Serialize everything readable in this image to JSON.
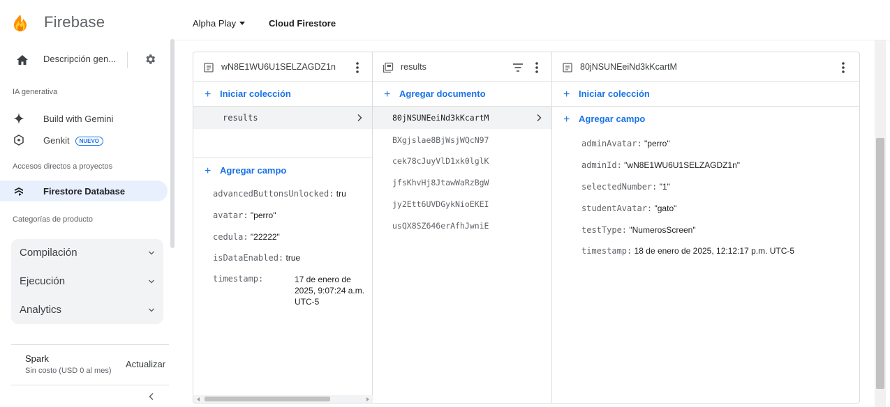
{
  "brand": {
    "name": "Firebase"
  },
  "sidebar": {
    "project_overview": "Descripción gen...",
    "section_genai": "IA generativa",
    "genai_items": [
      {
        "label": "Build with Gemini",
        "icon": "sparkle-icon"
      },
      {
        "label": "Genkit",
        "badge": "NUEVO",
        "icon": "genkit-icon"
      }
    ],
    "section_shortcuts": "Accesos directos a proyectos",
    "active_item": {
      "label": "Firestore Database",
      "icon": "firestore-icon"
    },
    "section_categories": "Categorías de producto",
    "categories": [
      {
        "label": "Compilación"
      },
      {
        "label": "Ejecución"
      },
      {
        "label": "Analytics"
      }
    ],
    "plan": {
      "name": "Spark",
      "subtitle": "Sin costo (USD 0 al mes)",
      "upgrade": "Actualizar"
    }
  },
  "topbar": {
    "project": "Alpha Play",
    "product": "Cloud Firestore"
  },
  "columns": {
    "root": {
      "title": "wN8E1WU6U1SELZAGDZ1n",
      "action": "Iniciar colección",
      "collections": [
        "results"
      ],
      "add_field": "Agregar campo",
      "fields": [
        {
          "key": "advancedButtonsUnlocked:",
          "value": "tru"
        },
        {
          "key": "avatar:",
          "value": "\"perro\""
        },
        {
          "key": "cedula:",
          "value": "\"22222\""
        },
        {
          "key": "isDataEnabled:",
          "value": "true"
        }
      ],
      "timestamp": {
        "key": "timestamp:",
        "value": "17 de enero de 2025, 9:07:24 a.m. UTC-5"
      }
    },
    "collection": {
      "title": "results",
      "action": "Agregar documento",
      "documents": [
        "80jNSUNEeiNd3kKcartM",
        "BXgjslae8BjWsjWQcN97",
        "cek78cJuyVlD1xk0lglK",
        "jfsKhvHj8JtawWaRzBgW",
        "jy2Ett6UVDGykNioEKEI",
        "usQX8SZ646erAfhJwniE"
      ]
    },
    "document": {
      "title": "80jNSUNEeiNd3kKcartM",
      "action": "Iniciar colección",
      "add_field": "Agregar campo",
      "fields": [
        {
          "key": "adminAvatar:",
          "value": "\"perro\""
        },
        {
          "key": "adminId:",
          "value": "\"wN8E1WU6U1SELZAGDZ1n\""
        },
        {
          "key": "selectedNumber:",
          "value": "\"1\""
        },
        {
          "key": "studentAvatar:",
          "value": "\"gato\""
        },
        {
          "key": "testType:",
          "value": "\"NumerosScreen\""
        },
        {
          "key": "timestamp:",
          "value": "18 de enero de 2025, 12:12:17 p.m. UTC-5"
        }
      ]
    }
  },
  "colors": {
    "accent": "#1a73e8",
    "active_bg": "#e8f0fe",
    "text": "#202124",
    "muted": "#5f6368",
    "flame": "#ffa000"
  }
}
